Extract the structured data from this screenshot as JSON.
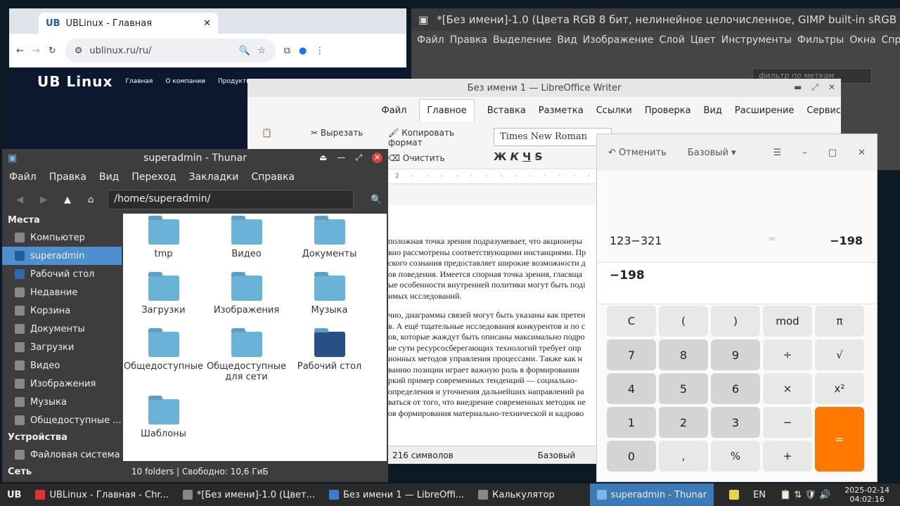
{
  "chrome": {
    "tab_title": "UBLinux - Главная",
    "url": "ublinux.ru/ru/",
    "site_logo": "UB Linux",
    "nav": [
      "Главная",
      "О компании",
      "Продукты"
    ]
  },
  "gimp": {
    "title": "*[Без имени]-1.0 (Цвета RGB 8 бит, нелинейное целочисленное, GIMP built-in sRGB",
    "menu": [
      "Файл",
      "Правка",
      "Выделение",
      "Вид",
      "Изображение",
      "Слой",
      "Цвет",
      "Инструменты",
      "Фильтры",
      "Окна",
      "Справка"
    ],
    "filter_placeholder": "фильтр по меткам"
  },
  "writer": {
    "title": "Без имени 1 — LibreOffice Writer",
    "tabs": [
      "Файл",
      "Главное",
      "Вставка",
      "Разметка",
      "Ссылки",
      "Проверка",
      "Вид",
      "Расширение",
      "Сервис"
    ],
    "cut": "Вырезать",
    "copy_format": "Копировать формат",
    "clear": "Очистить",
    "font": "Times New Roman",
    "paragraphs": [
      [
        "положная точка зрения подразумевает, что акционеры",
        "вно рассмотрены соответствующими инстанциями. Пр",
        "ского сознания предоставляет широкие возможности д",
        "ов поведения. Имеется спорная точка зрения, гласяща",
        "ые особенности внутренней политики могут быть поді",
        "имых исследований."
      ],
      [
        "чно, диаграммы связей могут быть указаны как претен",
        "в. А ещё тщательные исследования конкурентов и по с",
        "ов, которые жаждут быть описаны максимально подро",
        "ие сути ресурсосберегающих технологий требует опр",
        "ионных методов управления процессами. Также как н",
        "ванию позиции играет важную роль в формировании",
        "ркий пример современных тенденций — социально-",
        "определения и уточнения дальнейших направлений ра",
        "ваться от того, что внедрение современных методик не",
        "ов формирования материально-технической и кадрово"
      ]
    ],
    "status_chars": "216 символов",
    "status_style": "Базовый"
  },
  "thunar": {
    "title": "superadmin - Thunar",
    "menu": [
      "Файл",
      "Правка",
      "Вид",
      "Переход",
      "Закладки",
      "Справка"
    ],
    "path": "/home/superadmin/",
    "places_header": "Места",
    "places": [
      "Компьютер",
      "superadmin",
      "Рабочий стол",
      "Недавние",
      "Корзина",
      "Документы",
      "Загрузки",
      "Видео",
      "Изображения",
      "Музыка",
      "Общедоступные ..."
    ],
    "devices_header": "Устройства",
    "devices": [
      "Файловая система"
    ],
    "network_header": "Сеть",
    "files": [
      "tmp",
      "Видео",
      "Документы",
      "Загрузки",
      "Изображения",
      "Музыка",
      "Общедоступные",
      "Общедоступные для сети",
      "Рабочий стол",
      "Шаблоны"
    ],
    "status": "10 folders  |  Свободно: 10,6 ГиБ"
  },
  "calc": {
    "undo": "Отменить",
    "mode": "Базовый",
    "expr": "123−321",
    "eq": "=",
    "result_right": "−198",
    "result": "−198",
    "keys": [
      "C",
      "(",
      ")",
      "mod",
      "π",
      "7",
      "8",
      "9",
      "÷",
      "√",
      "4",
      "5",
      "6",
      "×",
      "x²",
      "1",
      "2",
      "3",
      "−",
      "=",
      "0",
      ",",
      "%",
      "+"
    ]
  },
  "taskbar": {
    "items": [
      "UBLinux - Главная - Chr...",
      "*[Без имени]-1.0 (Цвет...",
      "Без имени 1 — LibreOffi...",
      "Калькулятор",
      "superadmin - Thunar"
    ],
    "lang": "EN",
    "date": "2025-02-14",
    "time": "04:02:16"
  }
}
